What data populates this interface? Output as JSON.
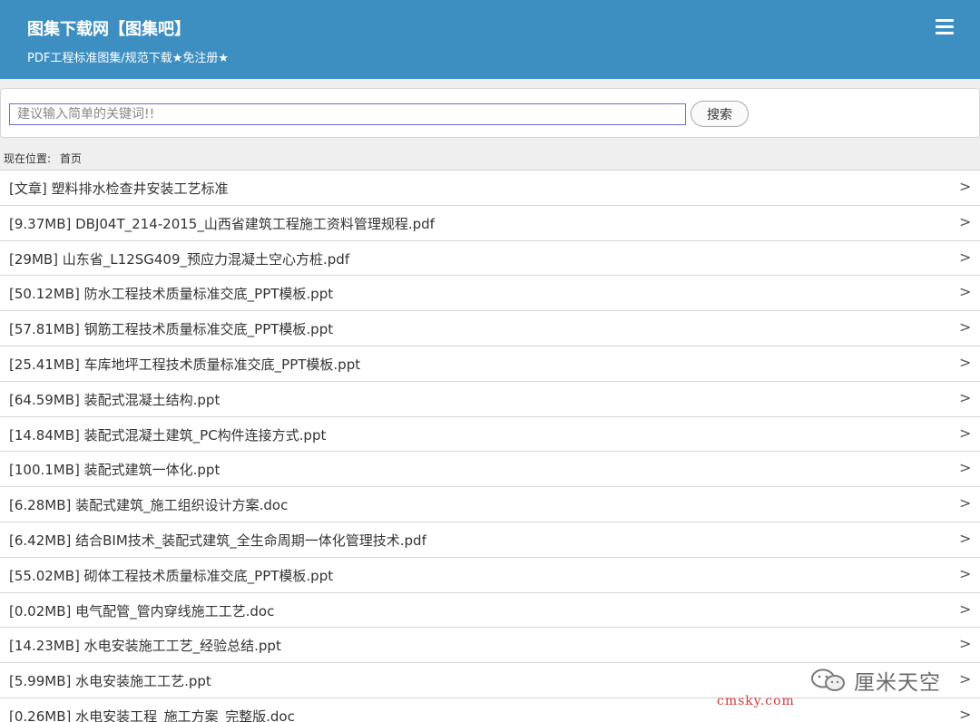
{
  "header": {
    "title": "图集下载网【图集吧】",
    "subtitle": "PDF工程标准图集/规范下载★免注册★",
    "menu_icon": "hamburger-menu-icon"
  },
  "search": {
    "placeholder": "建议输入简单的关键词!!",
    "value": "",
    "button_label": "搜索"
  },
  "breadcrumb": {
    "prefix": "现在位置:",
    "home": "首页"
  },
  "list": {
    "items": [
      {
        "label": "[文章] 塑料排水检查井安装工艺标准"
      },
      {
        "label": "[9.37MB] DBJ04T_214-2015_山西省建筑工程施工资料管理规程.pdf"
      },
      {
        "label": "[29MB] 山东省_L12SG409_预应力混凝土空心方桩.pdf"
      },
      {
        "label": "[50.12MB] 防水工程技术质量标准交底_PPT模板.ppt"
      },
      {
        "label": "[57.81MB] 钢筋工程技术质量标准交底_PPT模板.ppt"
      },
      {
        "label": "[25.41MB] 车库地坪工程技术质量标准交底_PPT模板.ppt"
      },
      {
        "label": "[64.59MB] 装配式混凝土结构.ppt"
      },
      {
        "label": "[14.84MB] 装配式混凝土建筑_PC构件连接方式.ppt"
      },
      {
        "label": "[100.1MB] 装配式建筑一体化.ppt"
      },
      {
        "label": "[6.28MB] 装配式建筑_施工组织设计方案.doc"
      },
      {
        "label": "[6.42MB] 结合BIM技术_装配式建筑_全生命周期一体化管理技术.pdf"
      },
      {
        "label": "[55.02MB] 砌体工程技术质量标准交底_PPT模板.ppt"
      },
      {
        "label": "[0.02MB] 电气配管_管内穿线施工工艺.doc"
      },
      {
        "label": "[14.23MB] 水电安装施工工艺_经验总结.ppt"
      },
      {
        "label": "[5.99MB] 水电安装施工工艺.ppt"
      },
      {
        "label": "[0.26MB] 水电安装工程_施工方案_完整版.doc"
      }
    ],
    "chevron": ">"
  },
  "watermark": {
    "name": "厘米天空",
    "url": "cmsky.com",
    "icon": "wechat-icon"
  },
  "colors": {
    "header_bg": "#3d8fc1",
    "page_bg": "#efefef",
    "watermark_url": "#d23a3a"
  }
}
